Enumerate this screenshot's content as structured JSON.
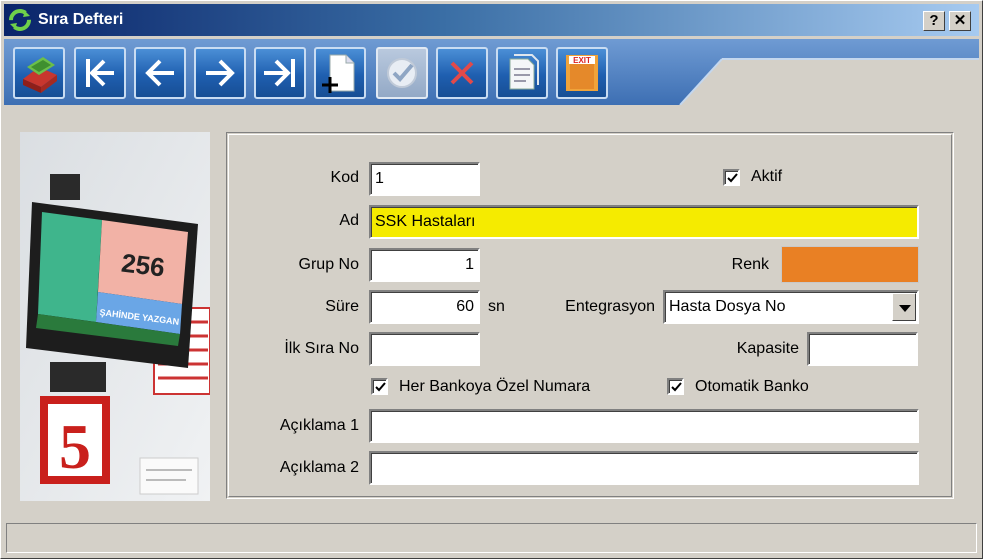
{
  "window": {
    "title": "Sıra Defteri",
    "help_label": "?",
    "close_label": "✕"
  },
  "toolbar": {
    "buttons": [
      {
        "name": "records",
        "icon": "cash-register-icon",
        "enabled": true
      },
      {
        "name": "first",
        "icon": "first-record-icon",
        "enabled": true
      },
      {
        "name": "previous",
        "icon": "arrow-left-icon",
        "enabled": true
      },
      {
        "name": "next",
        "icon": "arrow-right-icon",
        "enabled": true
      },
      {
        "name": "last",
        "icon": "last-record-icon",
        "enabled": true
      },
      {
        "name": "new",
        "icon": "new-document-icon",
        "enabled": true
      },
      {
        "name": "save",
        "icon": "checkmark-icon",
        "enabled": false
      },
      {
        "name": "cancel",
        "icon": "cross-icon",
        "enabled": true
      },
      {
        "name": "report",
        "icon": "report-icon",
        "enabled": true
      },
      {
        "name": "exit",
        "icon": "exit-door-icon",
        "enabled": true,
        "text": "EXIT"
      }
    ]
  },
  "photo": {
    "screen_number": "256",
    "screen_name": "ŞAHİNDE YAZGAN",
    "counter_number": "5"
  },
  "form": {
    "kod_label": "Kod",
    "kod_value": "1",
    "aktif_label": "Aktif",
    "aktif_checked": true,
    "ad_label": "Ad",
    "ad_value": "SSK Hastaları",
    "grup_no_label": "Grup No",
    "grup_no_value": "1",
    "renk_label": "Renk",
    "renk_color": "#e98024",
    "sure_label": "Süre",
    "sure_value": "60",
    "sure_unit": "sn",
    "entegrasyon_label": "Entegrasyon",
    "entegrasyon_value": "Hasta Dosya No",
    "ilk_sira_no_label": "İlk Sıra No",
    "ilk_sira_no_value": "",
    "kapasite_label": "Kapasite",
    "kapasite_value": "",
    "her_bankoya_label": "Her Bankoya Özel Numara",
    "her_bankoya_checked": true,
    "otomatik_banko_label": "Otomatik Banko",
    "otomatik_banko_checked": true,
    "aciklama1_label": "Açıklama 1",
    "aciklama1_value": "",
    "aciklama2_label": "Açıklama 2",
    "aciklama2_value": ""
  },
  "colors": {
    "titlebar_start": "#0a246a",
    "ad_field_bg": "#f5eb00",
    "toolbar_button": "#1f5fb0"
  },
  "statusbar": {
    "text": ""
  }
}
